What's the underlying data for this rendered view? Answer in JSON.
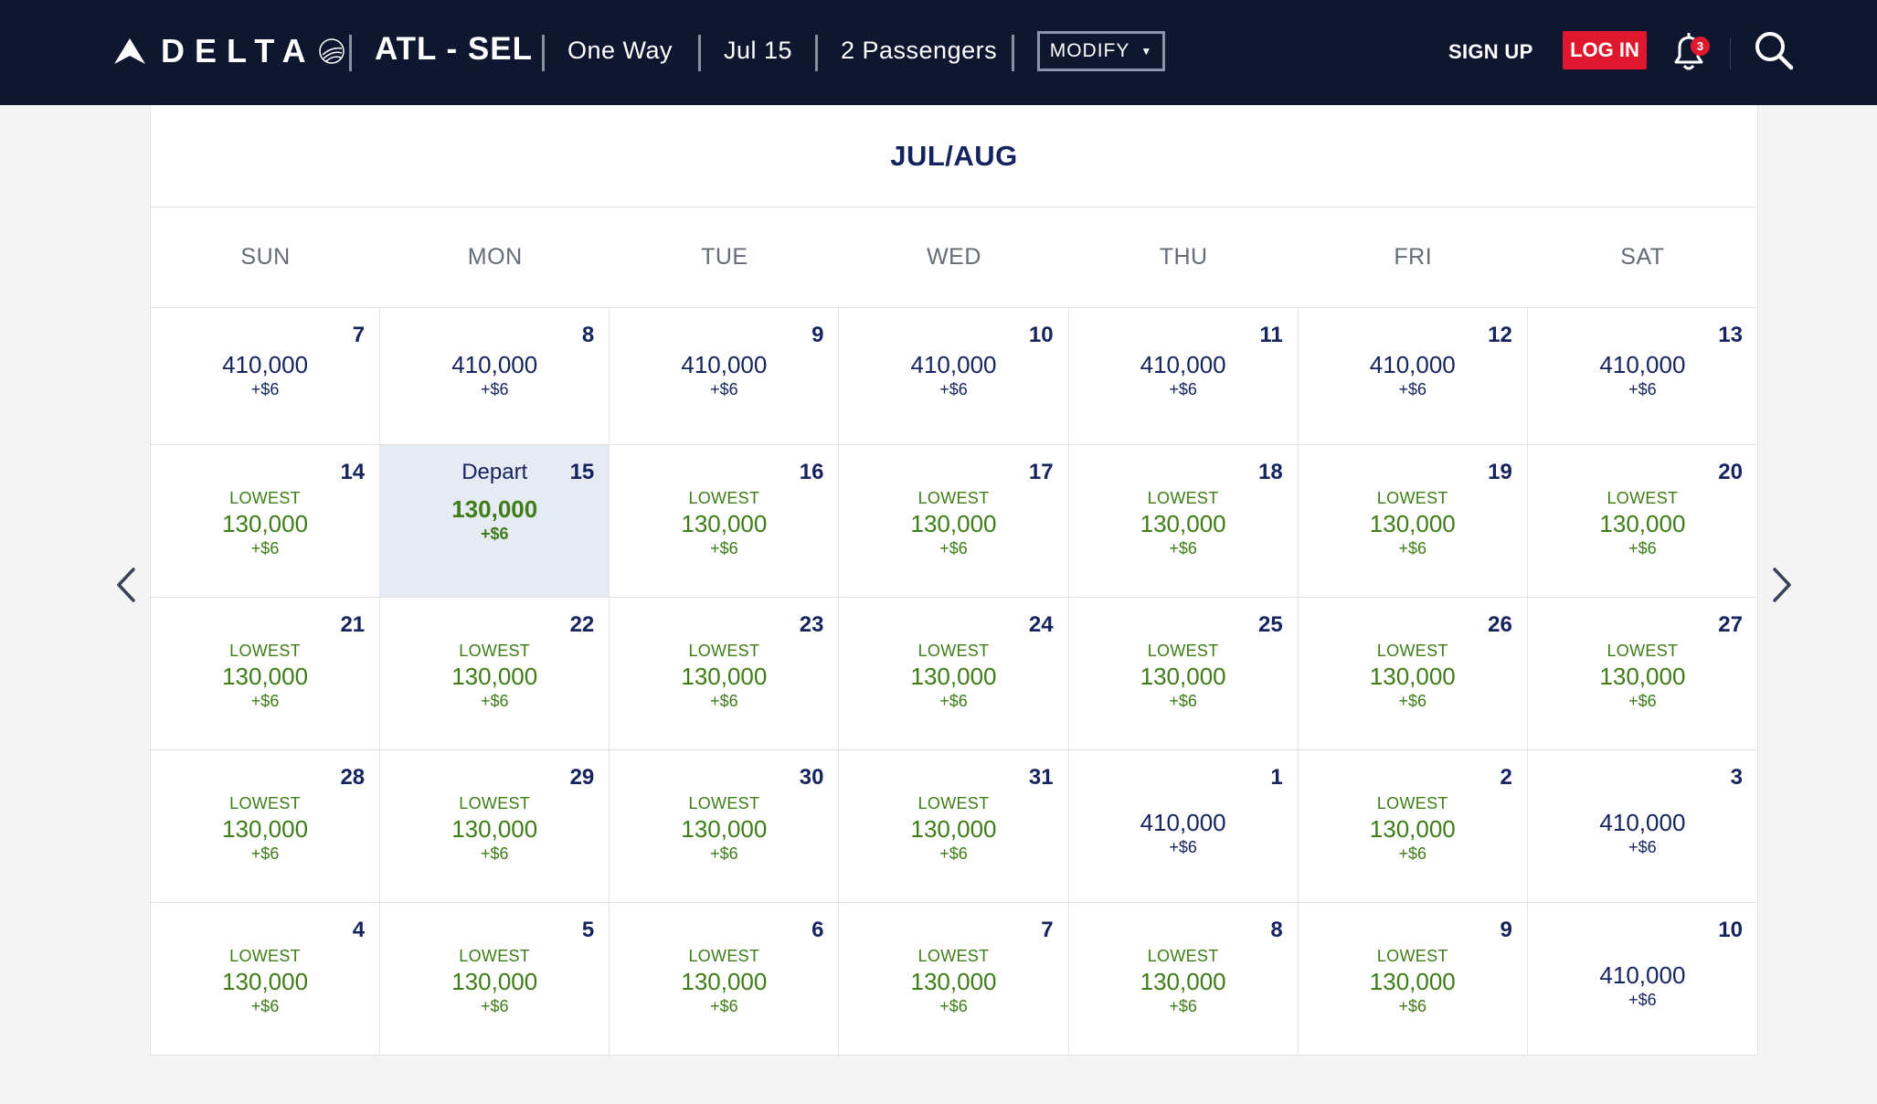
{
  "header": {
    "brand": "DELTA",
    "route": "ATL - SEL",
    "trip_type": "One Way",
    "date": "Jul 15",
    "passengers": "2 Passengers",
    "modify_label": "MODIFY",
    "signup_label": "SIGN UP",
    "login_label": "LOG IN",
    "notification_count": "3"
  },
  "calendar": {
    "month_title": "JUL/AUG",
    "weekdays": [
      "SUN",
      "MON",
      "TUE",
      "WED",
      "THU",
      "FRI",
      "SAT"
    ],
    "depart_label": "Depart",
    "lowest_label": "LOWEST",
    "days": [
      {
        "day": "7",
        "miles": "410,000",
        "fee": "+$6",
        "lowest": false,
        "selected": false
      },
      {
        "day": "8",
        "miles": "410,000",
        "fee": "+$6",
        "lowest": false,
        "selected": false
      },
      {
        "day": "9",
        "miles": "410,000",
        "fee": "+$6",
        "lowest": false,
        "selected": false
      },
      {
        "day": "10",
        "miles": "410,000",
        "fee": "+$6",
        "lowest": false,
        "selected": false
      },
      {
        "day": "11",
        "miles": "410,000",
        "fee": "+$6",
        "lowest": false,
        "selected": false
      },
      {
        "day": "12",
        "miles": "410,000",
        "fee": "+$6",
        "lowest": false,
        "selected": false
      },
      {
        "day": "13",
        "miles": "410,000",
        "fee": "+$6",
        "lowest": false,
        "selected": false
      },
      {
        "day": "14",
        "miles": "130,000",
        "fee": "+$6",
        "lowest": true,
        "selected": false
      },
      {
        "day": "15",
        "miles": "130,000",
        "fee": "+$6",
        "lowest": false,
        "selected": true
      },
      {
        "day": "16",
        "miles": "130,000",
        "fee": "+$6",
        "lowest": true,
        "selected": false
      },
      {
        "day": "17",
        "miles": "130,000",
        "fee": "+$6",
        "lowest": true,
        "selected": false
      },
      {
        "day": "18",
        "miles": "130,000",
        "fee": "+$6",
        "lowest": true,
        "selected": false
      },
      {
        "day": "19",
        "miles": "130,000",
        "fee": "+$6",
        "lowest": true,
        "selected": false
      },
      {
        "day": "20",
        "miles": "130,000",
        "fee": "+$6",
        "lowest": true,
        "selected": false
      },
      {
        "day": "21",
        "miles": "130,000",
        "fee": "+$6",
        "lowest": true,
        "selected": false
      },
      {
        "day": "22",
        "miles": "130,000",
        "fee": "+$6",
        "lowest": true,
        "selected": false
      },
      {
        "day": "23",
        "miles": "130,000",
        "fee": "+$6",
        "lowest": true,
        "selected": false
      },
      {
        "day": "24",
        "miles": "130,000",
        "fee": "+$6",
        "lowest": true,
        "selected": false
      },
      {
        "day": "25",
        "miles": "130,000",
        "fee": "+$6",
        "lowest": true,
        "selected": false
      },
      {
        "day": "26",
        "miles": "130,000",
        "fee": "+$6",
        "lowest": true,
        "selected": false
      },
      {
        "day": "27",
        "miles": "130,000",
        "fee": "+$6",
        "lowest": true,
        "selected": false
      },
      {
        "day": "28",
        "miles": "130,000",
        "fee": "+$6",
        "lowest": true,
        "selected": false
      },
      {
        "day": "29",
        "miles": "130,000",
        "fee": "+$6",
        "lowest": true,
        "selected": false
      },
      {
        "day": "30",
        "miles": "130,000",
        "fee": "+$6",
        "lowest": true,
        "selected": false
      },
      {
        "day": "31",
        "miles": "130,000",
        "fee": "+$6",
        "lowest": true,
        "selected": false
      },
      {
        "day": "1",
        "miles": "410,000",
        "fee": "+$6",
        "lowest": false,
        "selected": false
      },
      {
        "day": "2",
        "miles": "130,000",
        "fee": "+$6",
        "lowest": true,
        "selected": false
      },
      {
        "day": "3",
        "miles": "410,000",
        "fee": "+$6",
        "lowest": false,
        "selected": false
      },
      {
        "day": "4",
        "miles": "130,000",
        "fee": "+$6",
        "lowest": true,
        "selected": false
      },
      {
        "day": "5",
        "miles": "130,000",
        "fee": "+$6",
        "lowest": true,
        "selected": false
      },
      {
        "day": "6",
        "miles": "130,000",
        "fee": "+$6",
        "lowest": true,
        "selected": false
      },
      {
        "day": "7",
        "miles": "130,000",
        "fee": "+$6",
        "lowest": true,
        "selected": false
      },
      {
        "day": "8",
        "miles": "130,000",
        "fee": "+$6",
        "lowest": true,
        "selected": false
      },
      {
        "day": "9",
        "miles": "130,000",
        "fee": "+$6",
        "lowest": true,
        "selected": false
      },
      {
        "day": "10",
        "miles": "410,000",
        "fee": "+$6",
        "lowest": false,
        "selected": false
      }
    ]
  },
  "colors": {
    "header_bg": "#0f1730",
    "navy_text": "#15235e",
    "lowest_green": "#3e7c17",
    "login_red": "#e0182d",
    "selected_bg": "#e6ebf3"
  },
  "icons": {
    "logo": "delta-widget-icon",
    "globe": "skyteam-globe-icon",
    "bell": "bell-icon",
    "search": "search-icon",
    "prev": "chevron-left-icon",
    "next": "chevron-right-icon"
  }
}
